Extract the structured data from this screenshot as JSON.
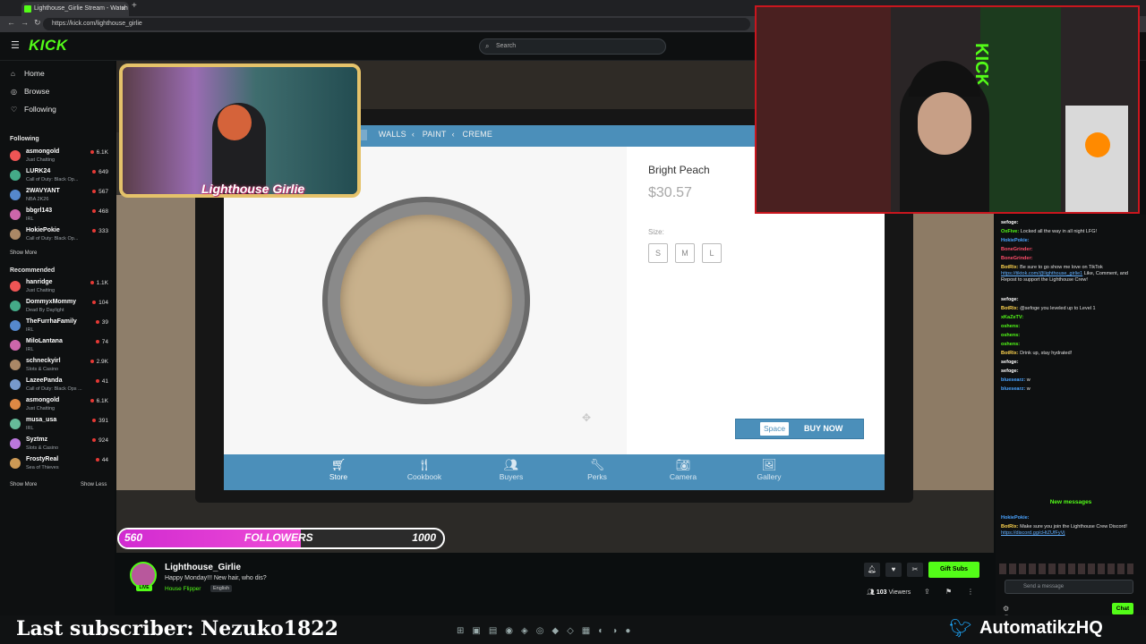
{
  "browser": {
    "tab_title": "Lighthouse_Girlie Stream - Watch",
    "url": "https://kick.com/lighthouse_girlie"
  },
  "header": {
    "logo": "KICK",
    "search_placeholder": "Search"
  },
  "sidebar": {
    "nav": [
      {
        "label": "Home",
        "icon": "home-icon"
      },
      {
        "label": "Browse",
        "icon": "compass-icon"
      },
      {
        "label": "Following",
        "icon": "heart-icon"
      }
    ],
    "following_header": "Following",
    "following": [
      {
        "name": "asmongold",
        "category": "Just Chatting",
        "viewers": "6.1K"
      },
      {
        "name": "LURK24",
        "category": "Call of Duty: Black Op...",
        "viewers": "649"
      },
      {
        "name": "2WAVYANT",
        "category": "NBA 2K26",
        "viewers": "567"
      },
      {
        "name": "bbgrl143",
        "category": "IRL",
        "viewers": "468"
      },
      {
        "name": "HokiePokie",
        "category": "Call of Duty: Black Op...",
        "viewers": "333"
      }
    ],
    "show_more": "Show More",
    "recommended_header": "Recommended",
    "recommended": [
      {
        "name": "hanridge",
        "category": "Just Chatting",
        "viewers": "1.1K"
      },
      {
        "name": "DommyxMommy",
        "category": "Dead By Daylight",
        "viewers": "104"
      },
      {
        "name": "TheFurrhaFamily",
        "category": "IRL",
        "viewers": "39"
      },
      {
        "name": "MiloLantana",
        "category": "IRL",
        "viewers": "74"
      },
      {
        "name": "schneckyirl",
        "category": "Slots & Casino",
        "viewers": "2.9K"
      },
      {
        "name": "LazeePanda",
        "category": "Call of Duty: Black Ops ...",
        "viewers": "41"
      },
      {
        "name": "asmongold",
        "category": "Just Chatting",
        "viewers": "6.1K"
      },
      {
        "name": "musa_usa",
        "category": "IRL",
        "viewers": "391"
      },
      {
        "name": "Syztmz",
        "category": "Slots & Casino",
        "viewers": "924"
      },
      {
        "name": "FrostyReal",
        "category": "Sea of Thieves",
        "viewers": "44"
      }
    ],
    "show_more_2": "Show More",
    "show_less": "Show Less"
  },
  "game": {
    "breadcrumb": [
      "WALLS",
      "PAINT",
      "CREME"
    ],
    "product_name": "Bright Peach",
    "price": "$30.57",
    "size_label": "Size:",
    "sizes": [
      "S",
      "M",
      "L"
    ],
    "buy_key": "Space",
    "buy_label": "BUY NOW",
    "tabs": [
      {
        "label": "Store",
        "icon": "cart-icon"
      },
      {
        "label": "Cookbook",
        "icon": "utensils-icon"
      },
      {
        "label": "Buyers",
        "icon": "people-icon"
      },
      {
        "label": "Perks",
        "icon": "wrench-icon"
      },
      {
        "label": "Camera",
        "icon": "camera-icon"
      },
      {
        "label": "Gallery",
        "icon": "image-icon"
      }
    ]
  },
  "overlay": {
    "cam_logo": "Lighthouse Girlie",
    "followers_current": "560",
    "followers_label": "FOLLOWERS",
    "followers_goal": "1000",
    "followers_fraction": 0.56,
    "last_subscriber": "Last subscriber: Nezuko1822",
    "handle": "AutomatikzHQ"
  },
  "chat": {
    "messages": [
      {
        "user": "sefoge:",
        "text": "",
        "color": "#ffffff"
      },
      {
        "user": "OxFive:",
        "text": "Locked all the way in all night LFG!",
        "color": "#53fc18"
      },
      {
        "user": "HokiePokie:",
        "text": "",
        "color": "#4aa3ff"
      },
      {
        "user": "BoneGrinder:",
        "text": "",
        "color": "#ff4d6a"
      },
      {
        "user": "BoneGrinder:",
        "text": "",
        "color": "#ff4d6a"
      },
      {
        "user": "BotRix:",
        "text": "Be sure to go show me love on TikTok",
        "link": "https://tiktok.com/@lighthouse_girlie1",
        "after": "Like, Comment, and Repost to support the Lighthouse Crew!",
        "color": "#ffd54f"
      },
      {
        "user": "sefoge:",
        "text": "",
        "color": "#ffffff"
      },
      {
        "user": "BotRix:",
        "text": "@sefoge you leveled up to Level 1",
        "color": "#ffd54f"
      },
      {
        "user": "xKaZeTV:",
        "text": "",
        "color": "#53fc18"
      },
      {
        "user": "oshens:",
        "text": "",
        "color": "#53fc18"
      },
      {
        "user": "oshens:",
        "text": "",
        "color": "#53fc18"
      },
      {
        "user": "oshens:",
        "text": "",
        "color": "#53fc18"
      },
      {
        "user": "BotRix:",
        "text": "Drink up, stay hydrated!",
        "color": "#ffd54f"
      },
      {
        "user": "sefoge:",
        "text": "",
        "color": "#ffffff"
      },
      {
        "user": "sefoge:",
        "text": "",
        "color": "#ffffff"
      },
      {
        "user": "bluesearz:",
        "text": "w",
        "color": "#4aa3ff"
      },
      {
        "user": "bluesearz:",
        "text": "w",
        "color": "#4aa3ff"
      }
    ],
    "new_messages": "New messages",
    "latest": [
      {
        "user": "HokiePokie:",
        "text": "",
        "color": "#4aa3ff"
      },
      {
        "user": "BotRix:",
        "text": "Make sure you join the Lighthouse Crew Discord!",
        "link": "https://discord.gg/cHtZUfFyVj",
        "color": "#ffd54f"
      }
    ],
    "input_placeholder": "Send a message",
    "chat_button": "Chat"
  },
  "stream": {
    "streamer": "Lighthouse_Girlie",
    "title": "Happy Monday!!! New hair, who dis?",
    "category": "House Flipper",
    "language": "English",
    "live_badge": "LIVE",
    "viewers": "103",
    "viewers_label": "Viewers",
    "gift_subs": "Gift Subs"
  },
  "colors": {
    "kick_green": "#53fc18",
    "game_blue": "#4b8fba",
    "follow_pink": "#ee4bd6"
  }
}
